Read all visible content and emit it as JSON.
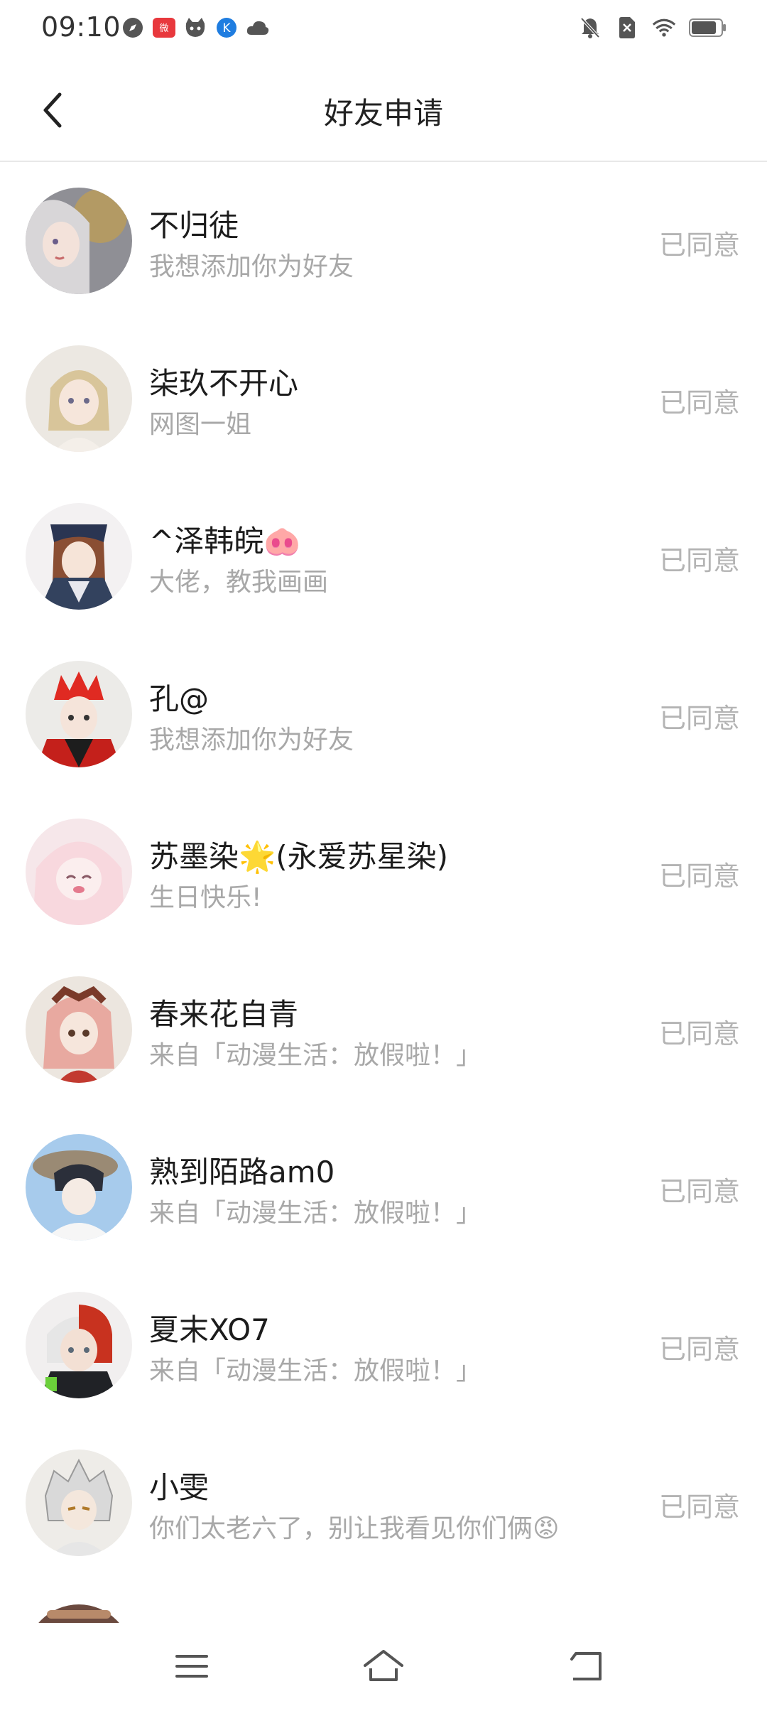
{
  "status_bar": {
    "time": "09:10",
    "left_icons": [
      "compass-icon",
      "weibo-icon",
      "cat-app-icon",
      "k-app-icon",
      "cloud-icon"
    ],
    "right_icons": [
      "bell-off-icon",
      "sim-off-icon",
      "wifi-icon",
      "battery-icon"
    ]
  },
  "header": {
    "title": "好友申请",
    "back_icon": "chevron-left-icon"
  },
  "requests": [
    {
      "name": "不归徒",
      "message": "我想添加你为好友",
      "status": "已同意"
    },
    {
      "name": "柒玖不开心",
      "message": "网图一姐",
      "status": "已同意"
    },
    {
      "name": "^泽韩皖",
      "name_emoji": "🐽",
      "message": "大佬，教我画画",
      "status": "已同意"
    },
    {
      "name": "孔@",
      "message": "我想添加你为好友",
      "status": "已同意"
    },
    {
      "name": "苏墨染🌟(永爱苏星染)",
      "message": "生日快乐!",
      "status": "已同意"
    },
    {
      "name": "春来花自青",
      "message": "来自「动漫生活：放假啦！」",
      "status": "已同意"
    },
    {
      "name": "熟到陌路am0",
      "message": "来自「动漫生活：放假啦！」",
      "status": "已同意"
    },
    {
      "name": "夏末XO7",
      "message": "来自「动漫生活：放假啦！」",
      "status": "已同意"
    },
    {
      "name": "小雯",
      "message": "你们太老六了，别让我看见你们俩😡",
      "status": "已同意"
    }
  ],
  "nav_bar": {
    "icons": [
      "menu-icon",
      "home-icon",
      "back-icon"
    ]
  }
}
